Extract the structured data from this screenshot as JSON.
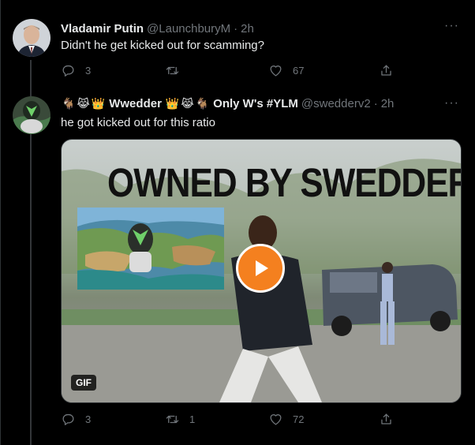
{
  "tweets": [
    {
      "name": "Vladamir Putin",
      "handle": "@LaunchburyM",
      "dot": "·",
      "time": "2h",
      "text": "Didn't he get kicked out for scamming?",
      "replies": "3",
      "retweets": "",
      "likes": "67"
    },
    {
      "name_prefix_emojis": [
        "🐐",
        "😹",
        "👑"
      ],
      "name": "Wwedder",
      "name_mid_emojis": [
        "👑",
        "😹",
        "🐐"
      ],
      "name_suffix": "Only W's #YLM",
      "handle": "@swedderv2",
      "dot": "·",
      "time": "2h",
      "text": "he got kicked out for this ratio",
      "media": {
        "overlay_text": "OWNED BY SWEDDER",
        "badge": "GIF"
      },
      "replies": "3",
      "retweets": "1",
      "likes": "72"
    }
  ],
  "more_label": "···",
  "icons": [
    "reply-icon",
    "retweet-icon",
    "like-icon",
    "share-icon",
    "play-icon"
  ],
  "colors": {
    "background": "#000000",
    "text": "#e7e9ea",
    "muted": "#71767b",
    "play_button": "#f4801f"
  }
}
